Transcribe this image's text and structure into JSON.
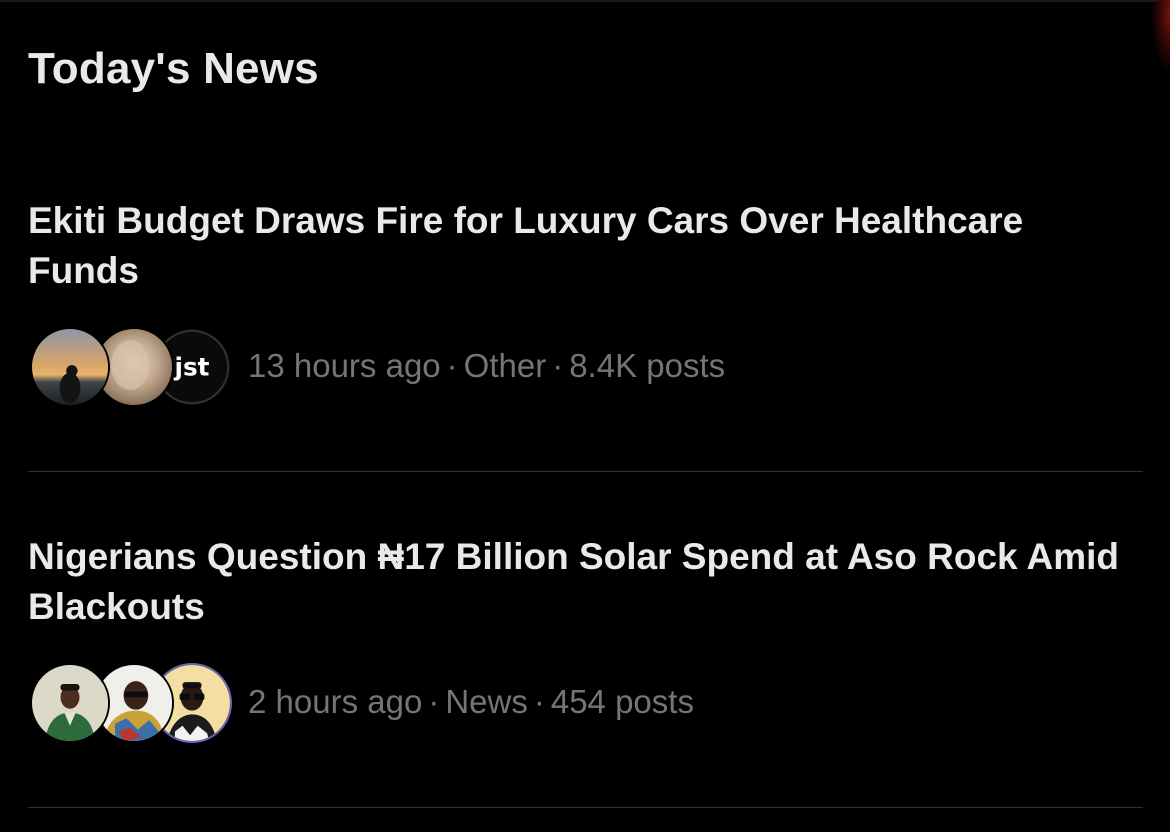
{
  "section": {
    "title": "Today's News"
  },
  "news": [
    {
      "headline": "Ekiti Budget Draws Fire for Luxury Cars Over Healthcare Funds",
      "time": "13 hours ago",
      "category": "Other",
      "posts": "8.4K posts",
      "avatars": [
        "sunset-silhouette-avatar",
        "blurred-face-avatar",
        "jst-logo-avatar"
      ],
      "logo_text": "jst"
    },
    {
      "headline": "Nigerians Question ₦17 Billion Solar Spend at Aso Rock Amid Blackouts",
      "time": "2 hours ago",
      "category": "News",
      "posts": "454 posts",
      "avatars": [
        "man-green-suit-avatar",
        "man-sunglasses-avatar",
        "man-glasses-avatar"
      ]
    }
  ],
  "separator": "·",
  "colors": {
    "background": "#000000",
    "text_primary": "#e7e9ea",
    "text_secondary": "#71767b",
    "divider": "#2f3336"
  }
}
